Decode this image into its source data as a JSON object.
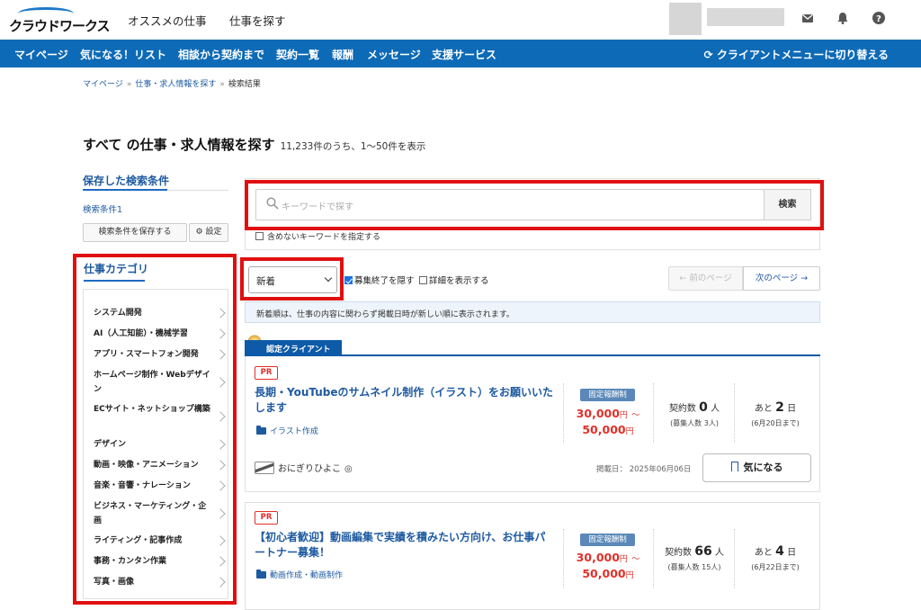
{
  "header": {
    "logo_text": "クラウドワークス",
    "links": [
      "オススメの仕事",
      "仕事を探す"
    ],
    "icons": [
      "mail-icon",
      "bell-icon",
      "help-icon"
    ]
  },
  "nav": {
    "items": [
      "マイページ",
      "気になる！リスト",
      "相談から契約まで",
      "契約一覧",
      "報酬",
      "メッセージ",
      "支援サービス"
    ],
    "switch_label": "クライアントメニューに切り替える"
  },
  "breadcrumb": [
    "マイページ",
    "仕事・求人情報を探す",
    "検索結果"
  ],
  "page": {
    "title_main": "すべて の仕事・求人情報を探す",
    "result_count": "11,233件のうち、1〜50件を表示"
  },
  "sidebar": {
    "saved_heading": "保存した検索条件",
    "saved_item": "検索条件1",
    "save_button": "検索条件を保存する",
    "settings_button": "設定",
    "category_heading": "仕事カテゴリ",
    "categories": [
      "システム開発",
      "AI（人工知能）・機械学習",
      "アプリ・スマートフォン開発",
      "ホームページ制作・Webデザイン",
      "ECサイト・ネットショップ構築",
      "デザイン",
      "動画・映像・アニメーション",
      "音楽・音響・ナレーション",
      "ビジネス・マーケティング・企画",
      "ライティング・記事作成",
      "事務・カンタン作業",
      "写真・画像"
    ]
  },
  "search": {
    "placeholder": "キーワードで探す",
    "button": "検索",
    "exclude_label": "含めないキーワードを指定する"
  },
  "sort": {
    "selected": "新着",
    "hide_closed": "募集終了を隠す",
    "hide_closed_checked": true,
    "show_detail": "詳細を表示する",
    "show_detail_checked": false,
    "prev": "← 前のページ",
    "next": "次のページ →",
    "notice": "新着順は、仕事の内容に関わらず掲載日時が新しい順に表示されます。"
  },
  "jobs": [
    {
      "certified_label": "認定クライアント",
      "pr": "PR",
      "title": "長期・YouTubeのサムネイル制作（イラスト）をお願いいたします",
      "category": "イラスト作成",
      "pay_type": "固定報酬制",
      "price_low": "30,000",
      "price_high": "50,000",
      "yen": "円",
      "range_sep": "〜",
      "contracts_label": "契約数",
      "contracts": "0",
      "person_unit": "人",
      "recruit": "(募集人数 3人)",
      "remain_prefix": "あと",
      "remain_days": "2",
      "day_unit": "日",
      "deadline": "(6月20日まで)",
      "client": "おにぎりひよこ",
      "posted": "掲載日： 2025年06月06日",
      "watch": "気になる"
    },
    {
      "pr": "PR",
      "title": "【初心者歓迎】動画編集で実績を積みたい方向け、お仕事パートナー募集！",
      "category": "動画作成・動画制作",
      "pay_type": "固定報酬制",
      "price_low": "30,000",
      "price_high": "50,000",
      "yen": "円",
      "range_sep": "〜",
      "contracts_label": "契約数",
      "contracts": "66",
      "person_unit": "人",
      "recruit": "(募集人数 15人)",
      "remain_prefix": "あと",
      "remain_days": "4",
      "day_unit": "日",
      "deadline": "(6月22日まで)"
    }
  ],
  "colors": {
    "brand": "#0d6ab6",
    "link": "#1e5aa0",
    "price": "#e0302a",
    "highlight": "#e01010"
  }
}
